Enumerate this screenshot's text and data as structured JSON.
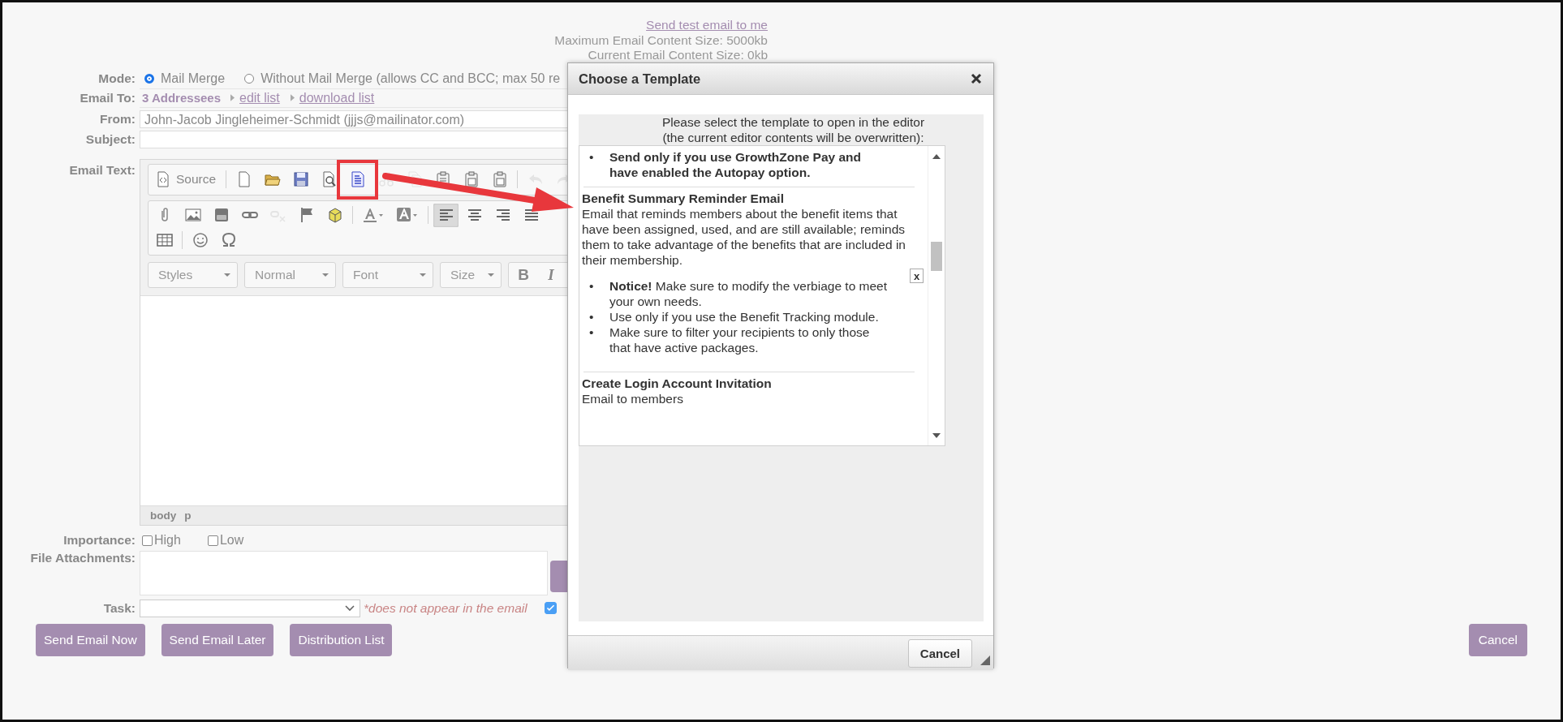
{
  "header": {
    "test_email_link": "Send test email to me",
    "max_size": "Maximum Email Content Size: 5000kb",
    "current_size": "Current Email Content Size: 0kb"
  },
  "form": {
    "mode": {
      "label": "Mode:",
      "options": [
        {
          "label": "Mail Merge",
          "selected": true
        },
        {
          "label": "Without Mail Merge (allows CC and BCC; max 50 re",
          "selected": false
        }
      ]
    },
    "email_to": {
      "label": "Email To:",
      "count": "3 Addressees",
      "links": [
        "edit list",
        "download list"
      ]
    },
    "from": {
      "label": "From:",
      "value": "John-Jacob Jingleheimer-Schmidt (jjjs@mailinator.com)"
    },
    "subject": {
      "label": "Subject:"
    },
    "email_text": {
      "label": "Email Text:",
      "source_label": "Source",
      "toolbar_row_1": [
        {
          "kind": "newpage",
          "disabled": false,
          "highlighted": false
        },
        {
          "kind": "open",
          "disabled": false,
          "highlighted": false
        },
        {
          "kind": "save",
          "disabled": false,
          "highlighted": false
        },
        {
          "kind": "preview",
          "disabled": false,
          "highlighted": false
        },
        {
          "kind": "templates",
          "disabled": false,
          "highlighted": true
        },
        {
          "kind": "cut",
          "disabled": true,
          "highlighted": false
        },
        {
          "kind": "copy",
          "disabled": true,
          "highlighted": false
        },
        {
          "kind": "paste",
          "disabled": false,
          "highlighted": false
        },
        {
          "kind": "pastetext",
          "disabled": false,
          "highlighted": false
        },
        {
          "kind": "pasteword",
          "disabled": false,
          "highlighted": false
        },
        {
          "kind": "undo",
          "disabled": true,
          "highlighted": false
        },
        {
          "kind": "redo",
          "disabled": true,
          "highlighted": false
        }
      ],
      "toolbar_row_2": [
        {
          "kind": "attach",
          "disabled": false
        },
        {
          "kind": "image",
          "disabled": false
        },
        {
          "kind": "video",
          "disabled": false
        },
        {
          "kind": "link",
          "disabled": false
        },
        {
          "kind": "unlink",
          "disabled": true
        },
        {
          "kind": "flag",
          "disabled": false
        },
        {
          "kind": "box",
          "disabled": false
        },
        {
          "kind": "textcolor",
          "disabled": false
        },
        {
          "kind": "bgcolor",
          "disabled": false
        }
      ],
      "align_buttons": [
        {
          "kind": "left",
          "selected": true
        },
        {
          "kind": "center",
          "selected": false
        },
        {
          "kind": "right",
          "selected": false
        },
        {
          "kind": "justify",
          "selected": false
        }
      ],
      "toolbar_row_3": [
        {
          "kind": "table",
          "disabled": false
        },
        {
          "kind": "smiley",
          "disabled": false
        },
        {
          "kind": "omega",
          "disabled": false
        }
      ],
      "dropdowns": [
        "Styles",
        "Normal",
        "Font",
        "Size"
      ],
      "format_buttons": [
        "B",
        "I"
      ],
      "path": [
        "body",
        "p"
      ]
    },
    "importance": {
      "label": "Importance:",
      "options": [
        {
          "label": "High",
          "checked": false
        },
        {
          "label": "Low",
          "checked": false
        }
      ]
    },
    "file_attachments": {
      "label": "File Attachments:"
    },
    "task": {
      "label": "Task:",
      "note": "*does not appear in the email",
      "checked": true
    }
  },
  "buttons": [
    "Send Email Now",
    "Send Email Later",
    "Distribution List"
  ],
  "cancel_button": "Cancel",
  "annotation_arrow": true,
  "dialog": {
    "title": "Choose a Template",
    "instructions": [
      "Please select the template to open in the editor",
      "(the current editor contents will be overwritten):"
    ],
    "templates": [
      {
        "bullets": [
          {
            "marker": "•",
            "text": "Send only if you use GrowthZone Pay and have enabled the Autopay option.",
            "bold": true
          }
        ]
      },
      {
        "title": "Benefit Summary Reminder Email",
        "description": "Email that reminds members about the benefit items that have been assigned, used, and are still available; reminds them to take advantage of the benefits that are included in their membership.",
        "close_mark": "x",
        "bullets": [
          {
            "marker": "•",
            "text": "**Notice!** Make sure to modify the verbiage to meet your own needs.",
            "bold": false
          },
          {
            "marker": "•",
            "text": "Use only if you use the Benefit Tracking module.",
            "bold": false
          },
          {
            "marker": "•",
            "text": "Make sure to filter your recipients to only those that have active packages.",
            "bold": false
          }
        ]
      },
      {
        "title": "Create Login Account Invitation",
        "description": "Email to members"
      }
    ],
    "cancel": "Cancel"
  }
}
